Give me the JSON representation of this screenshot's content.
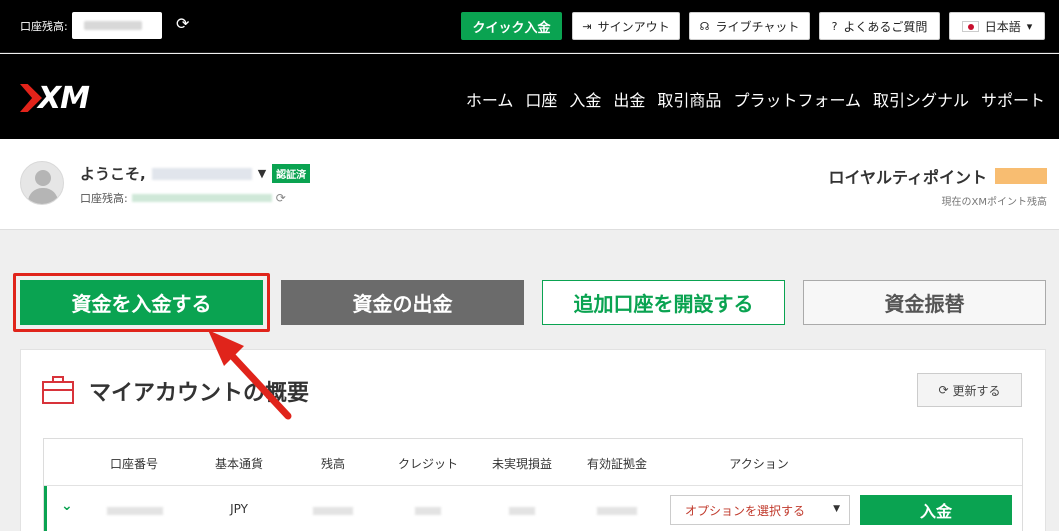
{
  "topbar": {
    "balance_label": "口座残高:",
    "quick_deposit": "クイック入金",
    "sign_out": "サインアウト",
    "live_chat": "ライブチャット",
    "faq": "よくあるご質問",
    "language": "日本語"
  },
  "header": {
    "logo": "XM",
    "nav": [
      "ホーム",
      "口座",
      "入金",
      "出金",
      "取引商品",
      "プラットフォーム",
      "取引シグナル",
      "サポート"
    ]
  },
  "welcome": {
    "greeting": "ようこそ,",
    "verified_badge": "認証済",
    "account_balance_label": "口座残高:",
    "loyalty_label": "ロイヤルティポイント",
    "loyalty_sub": "現在のXMポイント残高"
  },
  "actions": {
    "deposit": "資金を入金する",
    "withdraw": "資金の出金",
    "open_account": "追加口座を開設する",
    "transfer": "資金振替"
  },
  "panel": {
    "title": "マイアカウントの概要",
    "refresh": "更新する",
    "columns": [
      "口座番号",
      "基本通貨",
      "残高",
      "クレジット",
      "未実現損益",
      "有効証拠金",
      "アクション"
    ],
    "row": {
      "currency": "JPY",
      "option_select": "オプションを選択する",
      "deposit": "入金"
    }
  },
  "colors": {
    "brand_green": "#0aa351",
    "brand_red": "#e2231a",
    "highlight_red": "#e0241b"
  }
}
